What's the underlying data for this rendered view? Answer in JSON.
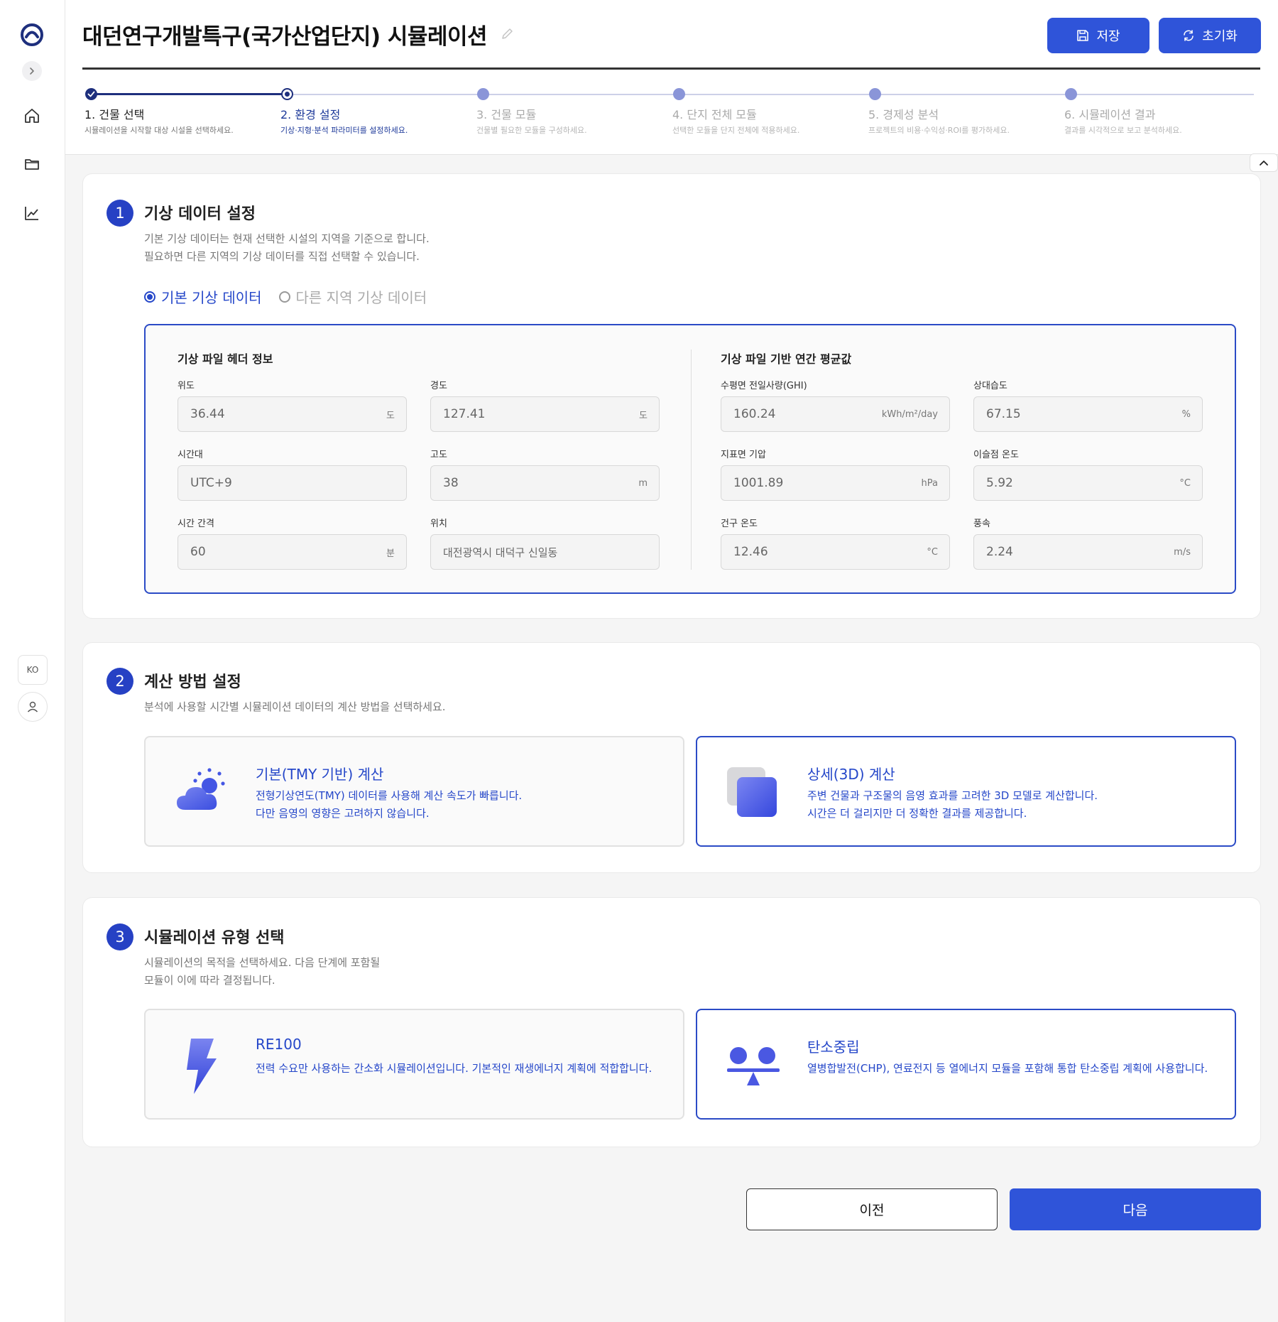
{
  "header": {
    "title": "대던연구개발특구(국가산업단지) 시뮬레이션",
    "save_label": "저장",
    "reset_label": "초기화"
  },
  "sidebar": {
    "language": "KO",
    "icons": [
      "logo-icon",
      "chevron-right-icon",
      "home-icon",
      "folder-icon",
      "chart-line-icon",
      "user-icon"
    ]
  },
  "stepper": {
    "current_step": 2,
    "steps": [
      {
        "label": "1. 건물 선택",
        "desc": "시뮬레이션을 시작할 대상 시설을 선택하세요.",
        "state": "done"
      },
      {
        "label": "2. 환경 설정",
        "desc": "기상·지형·분석 파라미터를 설정하세요.",
        "state": "active"
      },
      {
        "label": "3. 건물 모듈",
        "desc": "건물별 필요한 모듈을 구성하세요.",
        "state": "pending"
      },
      {
        "label": "4. 단지 전체 모듈",
        "desc": "선택한 모듈을 단지 전체에 적용하세요.",
        "state": "pending"
      },
      {
        "label": "5. 경제성 분석",
        "desc": "프로젝트의 비용·수익성·ROI를 평가하세요.",
        "state": "pending"
      },
      {
        "label": "6. 시뮬레이션 결과",
        "desc": "결과를 시각적으로 보고 분석하세요.",
        "state": "pending"
      }
    ]
  },
  "weather": {
    "number": "1",
    "title": "기상 데이터 설정",
    "desc_line1": "기본 기상 데이터는 현재 선택한 시설의 지역을 기준으로 합니다.",
    "desc_line2": "필요하면 다른 지역의 기상 데이터를 직접 선택할 수 있습니다.",
    "radio_default": "기본 기상 데이터",
    "radio_other": "다른 지역 기상 데이터",
    "selected_option": "기본 기상 데이터",
    "header_title": "기상 파일 헤더 정보",
    "avg_title": "기상 파일 기반 연간 평균값",
    "header_fields": [
      {
        "label": "위도",
        "value": "36.44",
        "unit": "도"
      },
      {
        "label": "경도",
        "value": "127.41",
        "unit": "도"
      },
      {
        "label": "시간대",
        "value": "UTC+9",
        "unit": ""
      },
      {
        "label": "고도",
        "value": "38",
        "unit": "m"
      },
      {
        "label": "시간 간격",
        "value": "60",
        "unit": "분"
      },
      {
        "label": "위치",
        "value": "대전광역시 대덕구 신일동",
        "unit": ""
      }
    ],
    "avg_fields": [
      {
        "label": "수평면 전일사량(GHI)",
        "value": "160.24",
        "unit": "kWh/m²/day"
      },
      {
        "label": "상대습도",
        "value": "67.15",
        "unit": "%"
      },
      {
        "label": "지표면 기압",
        "value": "1001.89",
        "unit": "hPa"
      },
      {
        "label": "이슬점 온도",
        "value": "5.92",
        "unit": "°C"
      },
      {
        "label": "건구 온도",
        "value": "12.46",
        "unit": "°C"
      },
      {
        "label": "풍속",
        "value": "2.24",
        "unit": "m/s"
      }
    ]
  },
  "calc": {
    "number": "2",
    "title": "계산 방법 설정",
    "desc": "분석에 사용할 시간별 시뮬레이션 데이터의 계산 방법을 선택하세요.",
    "selected_option": "상세(3D) 계산",
    "options": [
      {
        "title": "기본(TMY 기반) 계산",
        "desc_line1": "전형기상연도(TMY) 데이터를 사용해 계산 속도가 빠릅니다.",
        "desc_line2": "다만 음영의 영향은 고려하지 않습니다.",
        "icon": "weather-cloud-sun-icon"
      },
      {
        "title": "상세(3D) 계산",
        "desc_line1": "주변 건물과 구조물의 음영 효과를 고려한 3D 모델로 계산합니다.",
        "desc_line2": "시간은 더 걸리지만 더 정확한 결과를 제공합니다.",
        "icon": "3d-cube-icon"
      }
    ]
  },
  "simtype": {
    "number": "3",
    "title": "시뮬레이션 유형 선택",
    "desc_line1": "시뮬레이션의 목적을 선택하세요. 다음 단계에 포함될",
    "desc_line2": "모듈이 이에 따라 결정됩니다.",
    "selected_option": "탄소중립",
    "options": [
      {
        "title": "RE100",
        "desc": "전력 수요만 사용하는 간소화 시뮬레이션입니다. 기본적인 재생에너지 계획에 적합합니다.",
        "icon": "lightning-bolt-icon"
      },
      {
        "title": "탄소중립",
        "desc": "열병합발전(CHP), 연료전지 등 열에너지 모듈을 포함해 통합 탄소중립 계획에 사용합니다.",
        "icon": "balance-scale-icon"
      }
    ]
  },
  "footer": {
    "prev_label": "이전",
    "next_label": "다음"
  },
  "colors": {
    "primary": "#2f54d9",
    "accent_text": "#2547c9",
    "stepper_done": "#1e2f7d",
    "stepper_pending": "#8a95d8"
  }
}
